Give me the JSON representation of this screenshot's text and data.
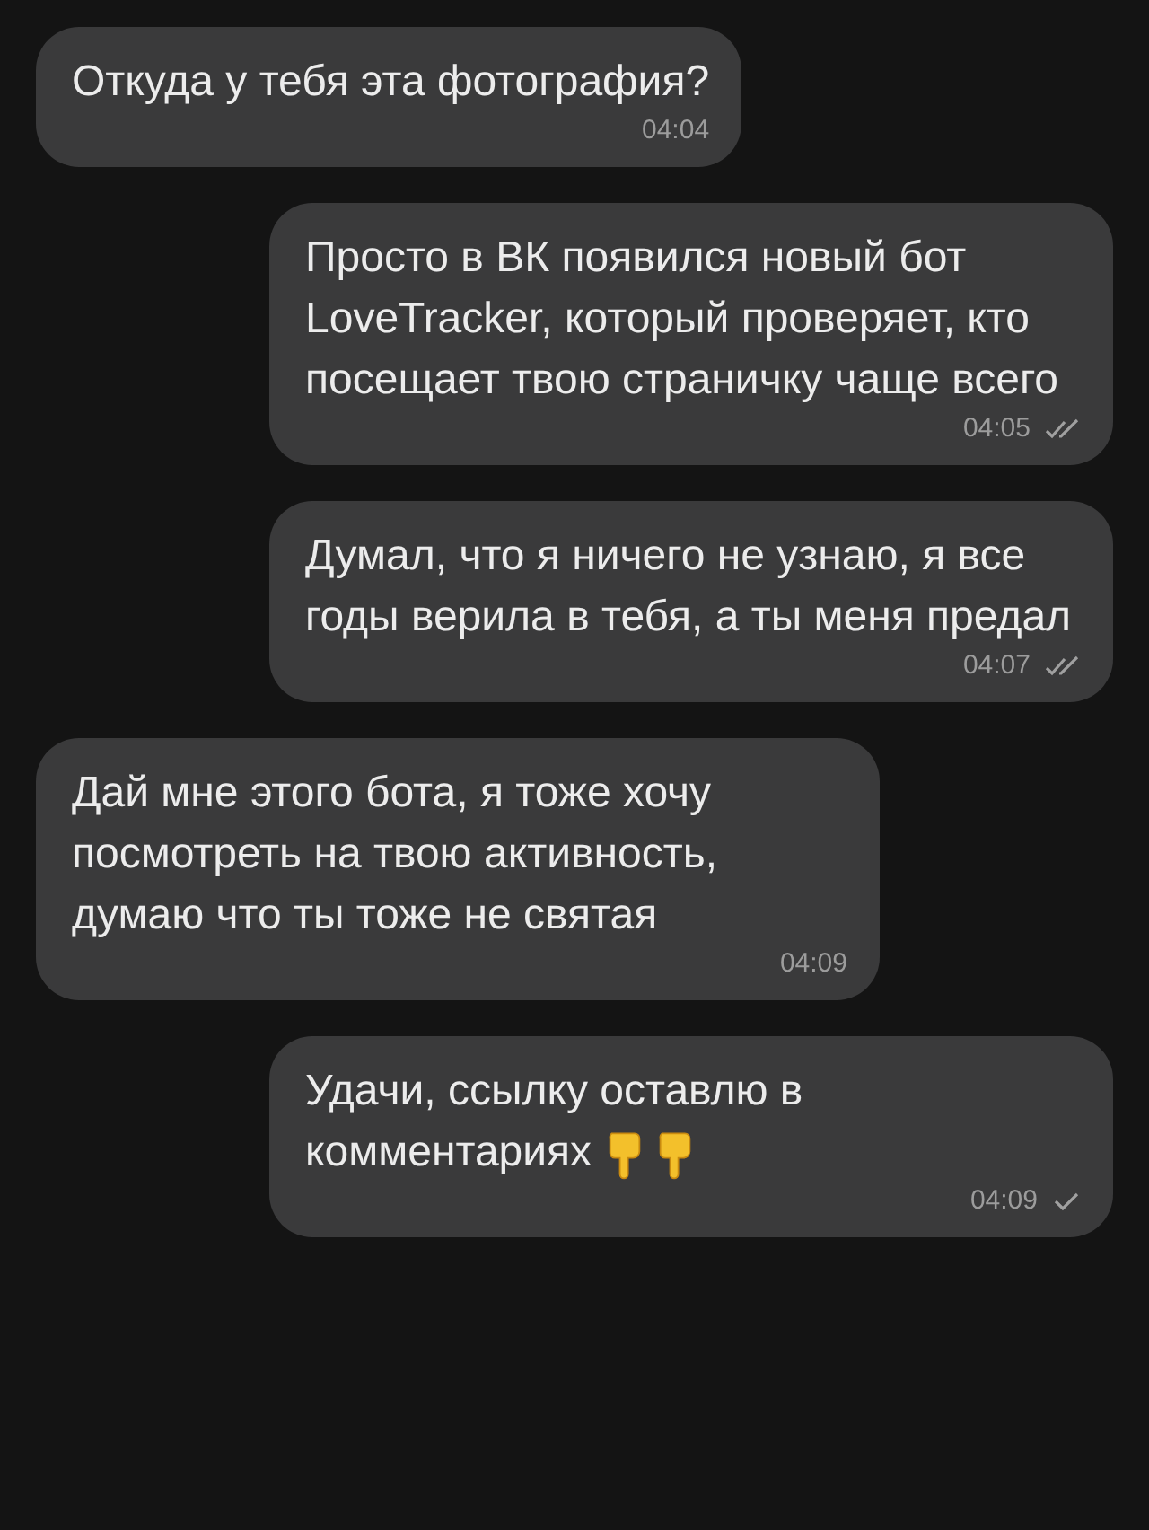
{
  "messages": [
    {
      "kind": "incoming",
      "text": "Откуда у тебя эта фотография?",
      "time": "04:04"
    },
    {
      "kind": "outgoing",
      "text": "Просто в ВК появился новый бот LoveTracker, который проверяет, кто посещает твою страничку чаще всего",
      "time": "04:05",
      "read": true
    },
    {
      "kind": "outgoing",
      "text": "Думал, что я ничего не узнаю, я все годы верила в тебя, а ты меня предал",
      "time": "04:07",
      "read": true
    },
    {
      "kind": "incoming",
      "text": "Дай мне этого бота,  я тоже хочу посмотреть на твою активность, думаю что ты тоже не святая",
      "time": "04:09"
    },
    {
      "kind": "outgoing",
      "text": "Удачи, ссылку оставлю в комментариях",
      "icons": [
        {
          "kind": "point-down"
        },
        {
          "kind": "point-down"
        }
      ],
      "time": "04:09",
      "read": false
    }
  ]
}
